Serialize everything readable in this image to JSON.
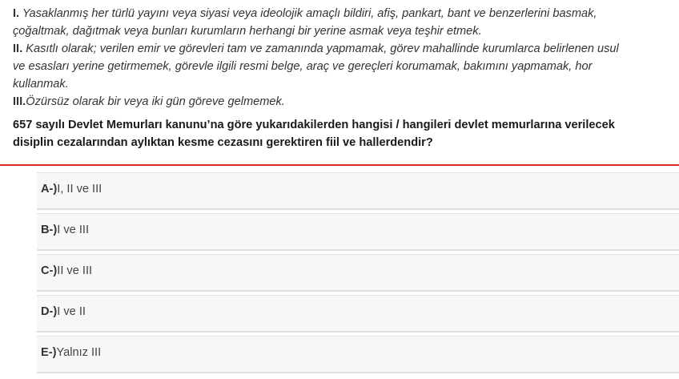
{
  "statements": [
    {
      "numeral": "I.",
      "lines": [
        " Yasaklanmış her türlü yayını veya siyasi veya ideolojik amaçlı bildiri, afiş, pankart, bant ve benzerlerini basmak,",
        "çoğaltmak, dağıtmak veya bunları kurumların herhangi bir yerine asmak veya teşhir etmek."
      ]
    },
    {
      "numeral": "II.",
      "lines": [
        " Kasıtlı olarak; verilen emir ve görevleri tam ve zamanında yapmamak, görev mahallinde kurumlarca belirlenen usul",
        "ve esasları yerine getirmemek, görevle ilgili resmi belge, araç ve gereçleri korumamak, bakımını yapmamak, hor",
        "kullanmak."
      ]
    },
    {
      "numeral": "III.",
      "lines": [
        "Özürsüz olarak bir veya iki gün göreve gelmemek."
      ]
    }
  ],
  "prompt_lines": [
    "657 sayılı Devlet Memurları kanunu’na göre yukarıdakilerden hangisi / hangileri devlet memurlarına verilecek",
    "disiplin cezalarından aylıktan kesme cezasını gerektiren fiil ve hallerdendir?"
  ],
  "options": [
    {
      "letter": "A-)",
      "text": "I, II ve III"
    },
    {
      "letter": "B-)",
      "text": "I ve III"
    },
    {
      "letter": "C-)",
      "text": "II ve III"
    },
    {
      "letter": "D-)",
      "text": "I ve II"
    },
    {
      "letter": "E-)",
      "text": "Yalnız III"
    }
  ],
  "colors": {
    "divider": "#d72b2b",
    "option_background": "#f7f7f7"
  }
}
